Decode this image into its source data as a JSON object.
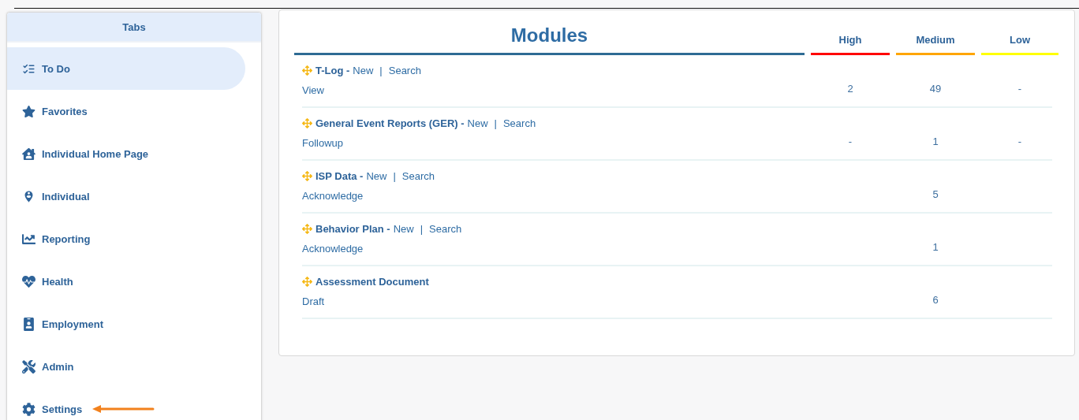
{
  "sidebar": {
    "title": "Tabs",
    "items": [
      {
        "label": "To Do",
        "selected": true
      },
      {
        "label": "Favorites",
        "selected": false
      },
      {
        "label": "Individual Home Page",
        "selected": false
      },
      {
        "label": "Individual",
        "selected": false
      },
      {
        "label": "Reporting",
        "selected": false
      },
      {
        "label": "Health",
        "selected": false
      },
      {
        "label": "Employment",
        "selected": false
      },
      {
        "label": "Admin",
        "selected": false
      },
      {
        "label": "Settings",
        "selected": false,
        "pointed": true
      }
    ]
  },
  "modules": {
    "title": "Modules",
    "columns": [
      {
        "label": "High",
        "color": "#ff0000"
      },
      {
        "label": "Medium",
        "color": "#ffa500"
      },
      {
        "label": "Low",
        "color": "#ffff00"
      }
    ],
    "rows": [
      {
        "name": "T-Log -",
        "actions": [
          {
            "kind": "link",
            "text": "New"
          },
          {
            "kind": "separator",
            "text": "|"
          },
          {
            "kind": "link",
            "text": "Search"
          }
        ],
        "task": "View",
        "high": "2",
        "medium": "49",
        "low": "-"
      },
      {
        "name": "General Event Reports (GER) -",
        "actions": [
          {
            "kind": "link",
            "text": "New"
          },
          {
            "kind": "separator",
            "text": "|"
          },
          {
            "kind": "link",
            "text": "Search"
          }
        ],
        "task": "Followup",
        "high": "-",
        "medium": "1",
        "low": "-"
      },
      {
        "name": "ISP Data -",
        "actions": [
          {
            "kind": "link",
            "text": "New"
          },
          {
            "kind": "separator",
            "text": "|"
          },
          {
            "kind": "link",
            "text": "Search"
          }
        ],
        "task": "Acknowledge",
        "medium": "5"
      },
      {
        "name": "Behavior Plan -",
        "actions": [
          {
            "kind": "link",
            "text": "New"
          },
          {
            "kind": "separator",
            "text": "|"
          },
          {
            "kind": "link",
            "text": "Search"
          }
        ],
        "task": "Acknowledge",
        "medium": "1"
      },
      {
        "name": "Assessment Document",
        "task": "Draft",
        "medium": "6"
      }
    ]
  }
}
